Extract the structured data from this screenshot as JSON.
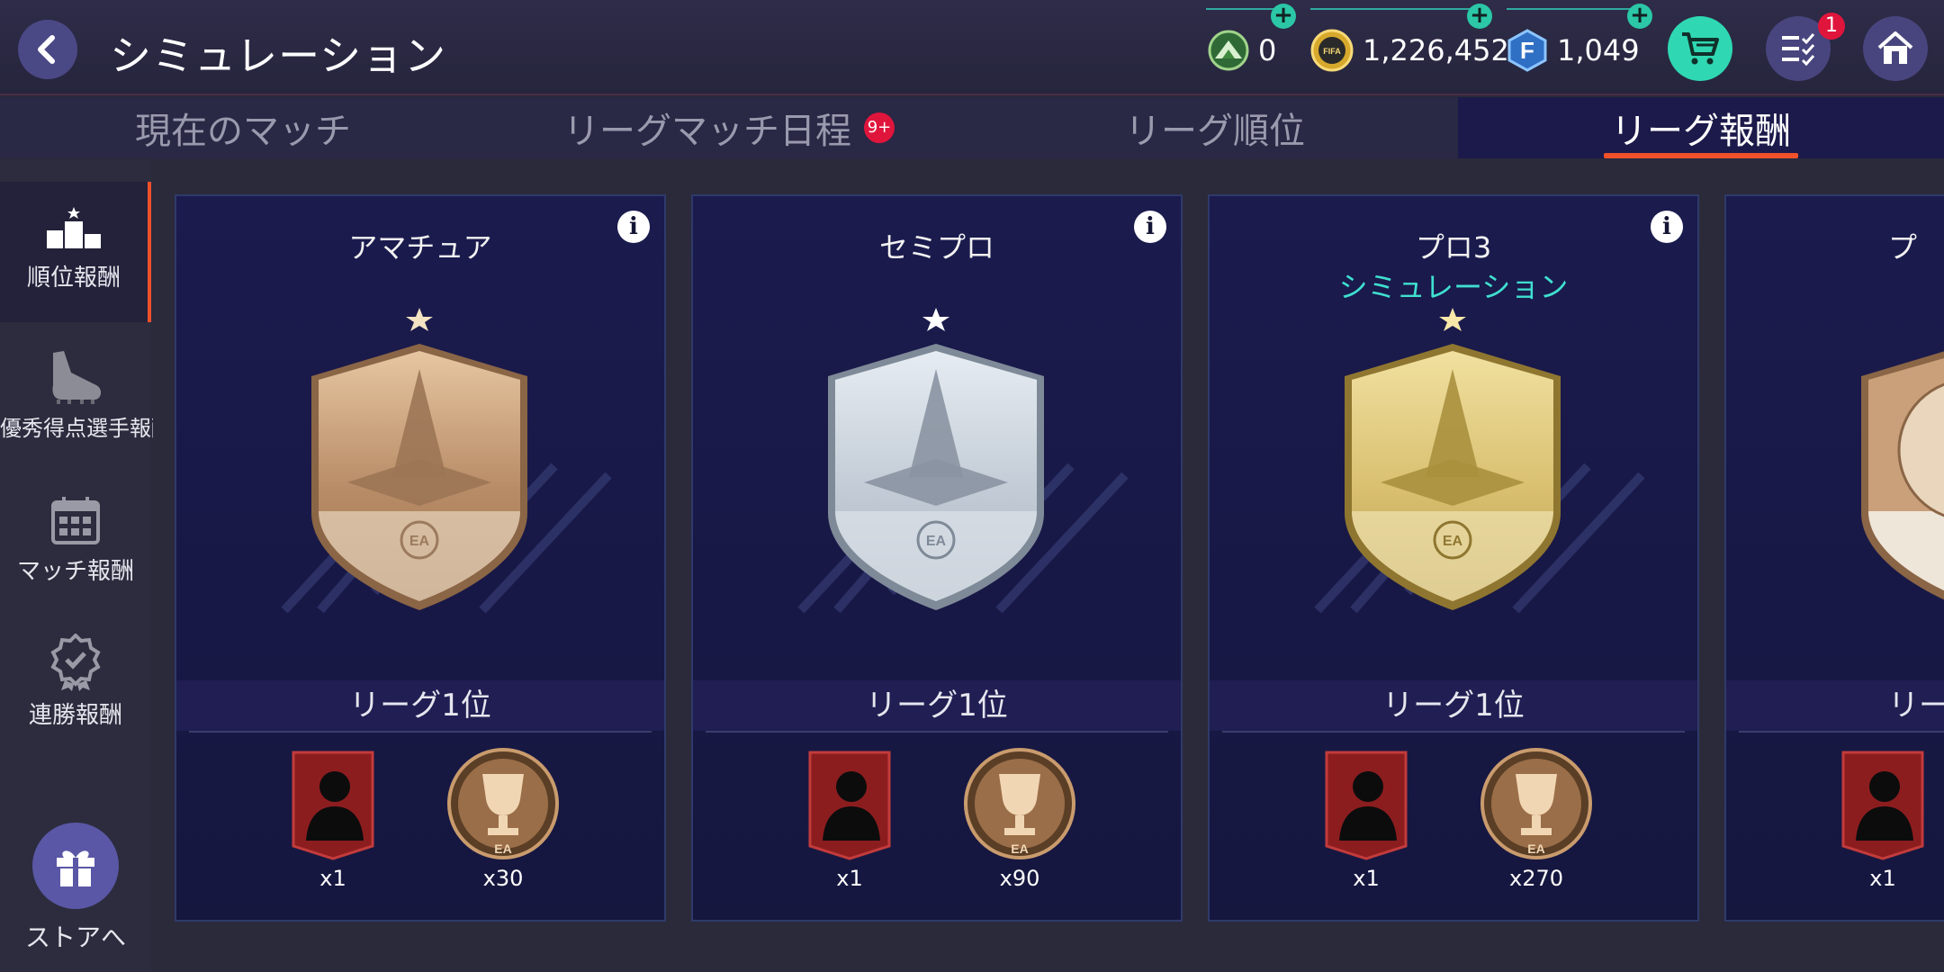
{
  "header": {
    "title": "シミュレーション",
    "currencies": [
      {
        "name": "token",
        "value": "0"
      },
      {
        "name": "coins",
        "value": "1,226,452"
      },
      {
        "name": "fifa-points",
        "value": "1,049"
      }
    ],
    "notification_count": "1",
    "coin_label": "FIFA"
  },
  "tabs": [
    {
      "label": "現在のマッチ"
    },
    {
      "label": "リーグマッチ日程",
      "badge": "9+"
    },
    {
      "label": "リーグ順位"
    },
    {
      "label": "リーグ報酬",
      "active": true
    }
  ],
  "sidebar": {
    "items": [
      {
        "label": "順位報酬",
        "active": true
      },
      {
        "label": "最優秀得点選手報酬"
      },
      {
        "label": "マッチ報酬"
      },
      {
        "label": "連勝報酬"
      }
    ],
    "store_label": "ストアへ"
  },
  "cards": [
    {
      "title": "アマチュア",
      "subtitle": "",
      "tier": "bronze",
      "rank_label": "リーグ1位",
      "rewards": [
        {
          "type": "player-card",
          "qty": "x1"
        },
        {
          "type": "trophy-token",
          "qty": "x30"
        }
      ]
    },
    {
      "title": "セミプロ",
      "subtitle": "",
      "tier": "silver",
      "rank_label": "リーグ1位",
      "rewards": [
        {
          "type": "player-card",
          "qty": "x1"
        },
        {
          "type": "trophy-token",
          "qty": "x90"
        }
      ]
    },
    {
      "title": "プロ3",
      "subtitle": "シミュレーション",
      "tier": "gold",
      "rank_label": "リーグ1位",
      "rewards": [
        {
          "type": "player-card",
          "qty": "x1"
        },
        {
          "type": "trophy-token",
          "qty": "x270"
        }
      ]
    },
    {
      "title": "プ",
      "subtitle": "",
      "tier": "ball",
      "rank_label": "リー",
      "rewards": [
        {
          "type": "player-card",
          "qty": "x1"
        }
      ]
    }
  ],
  "colors": {
    "accent_orange": "#f0512a",
    "teal": "#2fd8b2",
    "card_bg": "#1b1b4e",
    "badge_red": "#e0153c",
    "bronze": "#c9a07a",
    "silver": "#c3ccd6",
    "gold": "#d9c070"
  }
}
